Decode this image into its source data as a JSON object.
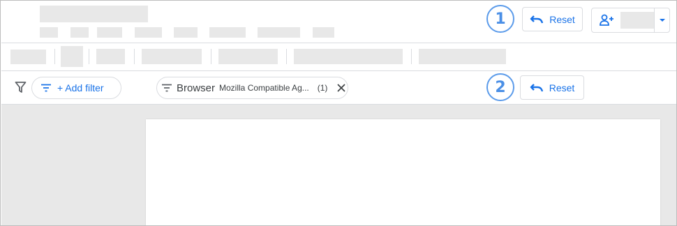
{
  "header": {
    "reset_top": {
      "label": "Reset",
      "callout": "1"
    },
    "share": {
      "icon": "add-person-icon",
      "caret_icon": "caret-down-icon"
    }
  },
  "filter_bar": {
    "filter_icon": "funnel-icon",
    "add_filter": {
      "label": "+ Add filter",
      "icon": "filter-lines-icon"
    },
    "chip": {
      "icon": "filter-lines-icon",
      "name": "Browser",
      "value": "Mozilla Compatible Ag...",
      "count": "(1)",
      "close_icon": "close-icon"
    },
    "reset": {
      "label": "Reset",
      "callout": "2"
    }
  },
  "colors": {
    "accent": "#1a73e8",
    "callout_ring": "#5b9bea",
    "placeholder": "#e8e8e8",
    "divider": "#dadce0",
    "canvas": "#e8e8e8"
  }
}
